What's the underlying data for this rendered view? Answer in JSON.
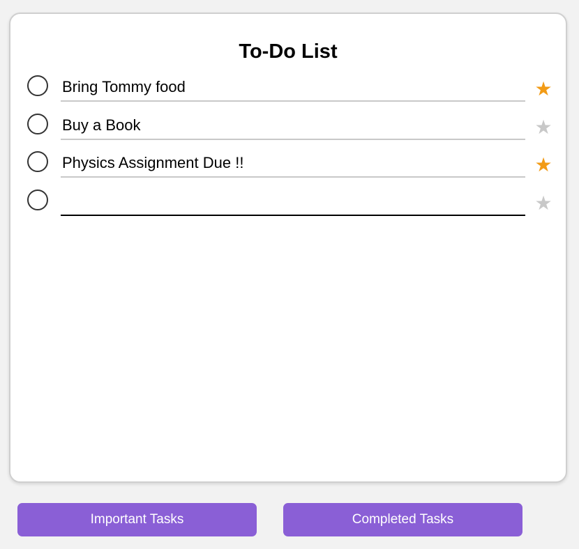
{
  "app": {
    "title": "To-Do List"
  },
  "tasks": [
    {
      "text": "Bring Tommy food",
      "important": true,
      "completed": false
    },
    {
      "text": "Buy a Book",
      "important": false,
      "completed": false
    },
    {
      "text": "Physics Assignment Due !!",
      "important": true,
      "completed": false
    },
    {
      "text": "",
      "important": false,
      "completed": false
    }
  ],
  "icons": {
    "star": "star-icon",
    "check": "circle-checkbox-icon"
  },
  "colors": {
    "star_on": "#f29b16",
    "star_off": "#c8c8c8",
    "button_bg": "#8a5fd6",
    "button_text": "#ffffff"
  },
  "footer": {
    "important_label": "Important Tasks",
    "completed_label": "Completed Tasks"
  }
}
